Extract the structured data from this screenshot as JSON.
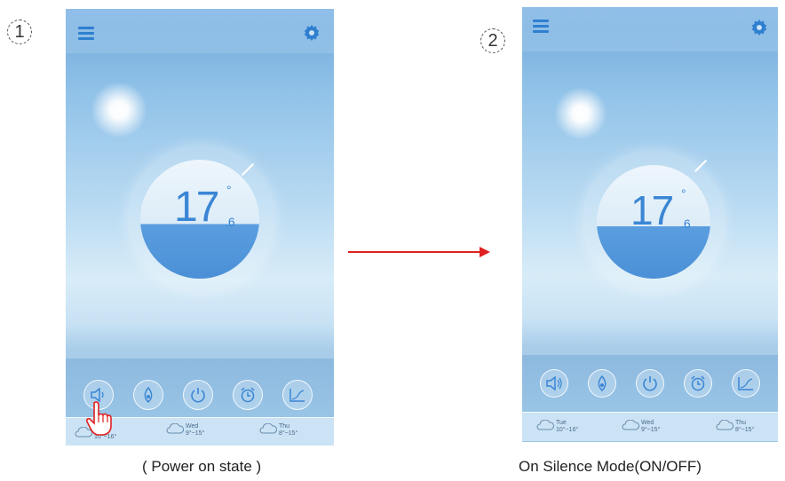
{
  "screens": [
    {
      "step": "1",
      "caption": "( Power on state  )",
      "temperature": {
        "integer": "17",
        "decimal": ".6",
        "degree": "°"
      },
      "controls": [
        "silence-icon",
        "fan-icon",
        "power-icon",
        "alarm-clock-icon",
        "curve-icon"
      ],
      "weather": [
        {
          "day": "Tue",
          "range": "10°~16°"
        },
        {
          "day": "Wed",
          "range": "9°~15°"
        },
        {
          "day": "Thu",
          "range": "8°~15°"
        }
      ]
    },
    {
      "step": "2",
      "caption": "On Silence Mode(ON/OFF)",
      "temperature": {
        "integer": "17",
        "decimal": ".6",
        "degree": "°"
      },
      "controls": [
        "silence-icon",
        "fan-icon",
        "power-icon",
        "alarm-clock-icon",
        "curve-icon"
      ],
      "weather": [
        {
          "day": "Tue",
          "range": "10°~16°"
        },
        {
          "day": "Wed",
          "range": "9°~15°"
        },
        {
          "day": "Thu",
          "range": "8°~15°"
        }
      ]
    }
  ],
  "colors": {
    "accent": "#3a86d4",
    "arrow": "#e02020"
  }
}
